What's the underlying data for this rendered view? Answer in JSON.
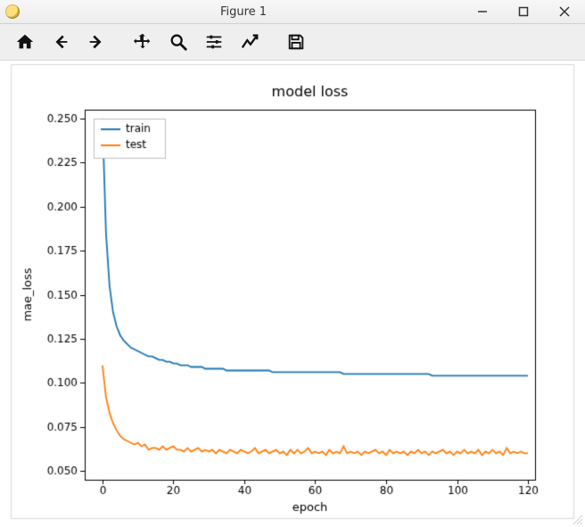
{
  "window": {
    "title": "Figure 1",
    "buttons": {
      "minimize": "Minimize",
      "maximize": "Maximize",
      "close": "Close"
    }
  },
  "toolbar": {
    "home": "Home",
    "back": "Back",
    "forward": "Forward",
    "pan": "Pan",
    "zoom": "Zoom",
    "configure": "Configure subplots",
    "axes": "Edit axis",
    "save": "Save"
  },
  "chart_data": {
    "type": "line",
    "title": "model loss",
    "xlabel": "epoch",
    "ylabel": "mae_loss",
    "xlim": [
      -5,
      122
    ],
    "ylim": [
      0.045,
      0.255
    ],
    "xticks": [
      0,
      20,
      40,
      60,
      80,
      100,
      120
    ],
    "yticks": [
      0.05,
      0.075,
      0.1,
      0.125,
      0.15,
      0.175,
      0.2,
      0.225,
      0.25
    ],
    "legend_position": "upper left",
    "series": [
      {
        "name": "train",
        "color": "#1f77b4",
        "x": [
          0,
          1,
          2,
          3,
          4,
          5,
          6,
          7,
          8,
          9,
          10,
          11,
          12,
          13,
          14,
          15,
          16,
          17,
          18,
          19,
          20,
          21,
          22,
          23,
          24,
          25,
          26,
          27,
          28,
          29,
          30,
          31,
          32,
          33,
          34,
          35,
          36,
          37,
          38,
          39,
          40,
          41,
          42,
          43,
          44,
          45,
          46,
          47,
          48,
          49,
          50,
          51,
          52,
          53,
          54,
          55,
          56,
          57,
          58,
          59,
          60,
          61,
          62,
          63,
          64,
          65,
          66,
          67,
          68,
          69,
          70,
          71,
          72,
          73,
          74,
          75,
          76,
          77,
          78,
          79,
          80,
          81,
          82,
          83,
          84,
          85,
          86,
          87,
          88,
          89,
          90,
          91,
          92,
          93,
          94,
          95,
          96,
          97,
          98,
          99,
          100,
          101,
          102,
          103,
          104,
          105,
          106,
          107,
          108,
          109,
          110,
          111,
          112,
          113,
          114,
          115,
          116,
          117,
          118,
          119,
          120
        ],
        "values": [
          0.25,
          0.185,
          0.155,
          0.14,
          0.132,
          0.127,
          0.124,
          0.122,
          0.12,
          0.119,
          0.118,
          0.117,
          0.116,
          0.115,
          0.115,
          0.114,
          0.113,
          0.113,
          0.112,
          0.112,
          0.111,
          0.111,
          0.11,
          0.11,
          0.11,
          0.109,
          0.109,
          0.109,
          0.109,
          0.108,
          0.108,
          0.108,
          0.108,
          0.108,
          0.108,
          0.107,
          0.107,
          0.107,
          0.107,
          0.107,
          0.107,
          0.107,
          0.107,
          0.107,
          0.107,
          0.107,
          0.107,
          0.107,
          0.106,
          0.106,
          0.106,
          0.106,
          0.106,
          0.106,
          0.106,
          0.106,
          0.106,
          0.106,
          0.106,
          0.106,
          0.106,
          0.106,
          0.106,
          0.106,
          0.106,
          0.106,
          0.106,
          0.106,
          0.105,
          0.105,
          0.105,
          0.105,
          0.105,
          0.105,
          0.105,
          0.105,
          0.105,
          0.105,
          0.105,
          0.105,
          0.105,
          0.105,
          0.105,
          0.105,
          0.105,
          0.105,
          0.105,
          0.105,
          0.105,
          0.105,
          0.105,
          0.105,
          0.105,
          0.104,
          0.104,
          0.104,
          0.104,
          0.104,
          0.104,
          0.104,
          0.104,
          0.104,
          0.104,
          0.104,
          0.104,
          0.104,
          0.104,
          0.104,
          0.104,
          0.104,
          0.104,
          0.104,
          0.104,
          0.104,
          0.104,
          0.104,
          0.104,
          0.104,
          0.104,
          0.104,
          0.104
        ]
      },
      {
        "name": "test",
        "color": "#ff7f0e",
        "x": [
          0,
          1,
          2,
          3,
          4,
          5,
          6,
          7,
          8,
          9,
          10,
          11,
          12,
          13,
          14,
          15,
          16,
          17,
          18,
          19,
          20,
          21,
          22,
          23,
          24,
          25,
          26,
          27,
          28,
          29,
          30,
          31,
          32,
          33,
          34,
          35,
          36,
          37,
          38,
          39,
          40,
          41,
          42,
          43,
          44,
          45,
          46,
          47,
          48,
          49,
          50,
          51,
          52,
          53,
          54,
          55,
          56,
          57,
          58,
          59,
          60,
          61,
          62,
          63,
          64,
          65,
          66,
          67,
          68,
          69,
          70,
          71,
          72,
          73,
          74,
          75,
          76,
          77,
          78,
          79,
          80,
          81,
          82,
          83,
          84,
          85,
          86,
          87,
          88,
          89,
          90,
          91,
          92,
          93,
          94,
          95,
          96,
          97,
          98,
          99,
          100,
          101,
          102,
          103,
          104,
          105,
          106,
          107,
          108,
          109,
          110,
          111,
          112,
          113,
          114,
          115,
          116,
          117,
          118,
          119,
          120
        ],
        "values": [
          0.11,
          0.092,
          0.083,
          0.077,
          0.073,
          0.07,
          0.068,
          0.067,
          0.066,
          0.065,
          0.066,
          0.064,
          0.065,
          0.062,
          0.063,
          0.063,
          0.062,
          0.064,
          0.062,
          0.063,
          0.064,
          0.062,
          0.062,
          0.061,
          0.063,
          0.061,
          0.062,
          0.063,
          0.061,
          0.062,
          0.061,
          0.062,
          0.06,
          0.062,
          0.061,
          0.06,
          0.062,
          0.061,
          0.06,
          0.062,
          0.061,
          0.06,
          0.061,
          0.063,
          0.06,
          0.061,
          0.062,
          0.06,
          0.061,
          0.062,
          0.06,
          0.061,
          0.059,
          0.062,
          0.06,
          0.062,
          0.06,
          0.061,
          0.063,
          0.06,
          0.061,
          0.06,
          0.061,
          0.059,
          0.062,
          0.06,
          0.061,
          0.06,
          0.064,
          0.06,
          0.061,
          0.06,
          0.061,
          0.059,
          0.061,
          0.06,
          0.061,
          0.062,
          0.06,
          0.061,
          0.059,
          0.062,
          0.06,
          0.061,
          0.06,
          0.061,
          0.059,
          0.061,
          0.06,
          0.062,
          0.06,
          0.061,
          0.059,
          0.061,
          0.06,
          0.061,
          0.062,
          0.06,
          0.061,
          0.059,
          0.061,
          0.06,
          0.062,
          0.06,
          0.061,
          0.06,
          0.062,
          0.059,
          0.061,
          0.06,
          0.062,
          0.06,
          0.061,
          0.059,
          0.063,
          0.06,
          0.061,
          0.06,
          0.061,
          0.06,
          0.06
        ]
      }
    ]
  }
}
